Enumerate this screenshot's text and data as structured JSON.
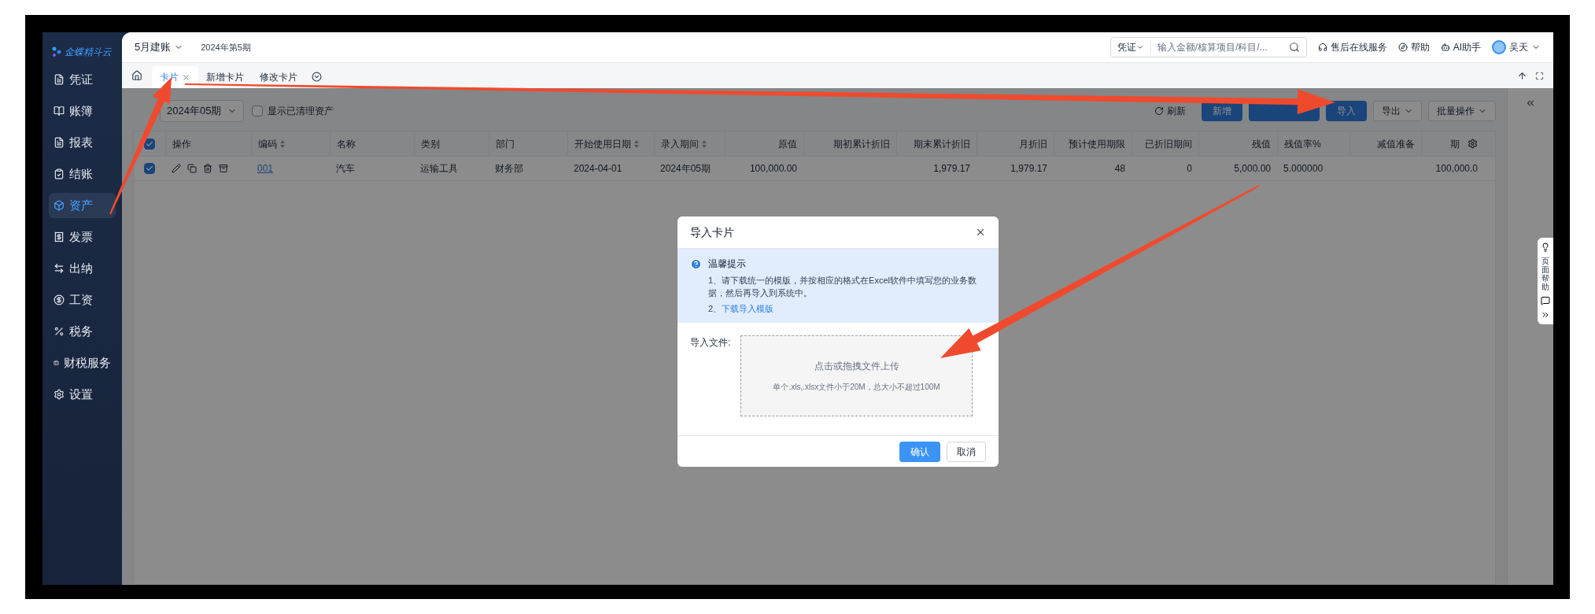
{
  "logo": "金蝶精斗云",
  "sidebar": {
    "items": [
      {
        "label": "凭证",
        "selected": false
      },
      {
        "label": "账簿",
        "selected": false
      },
      {
        "label": "报表",
        "selected": false
      },
      {
        "label": "结账",
        "selected": false
      },
      {
        "label": "资产",
        "selected": true
      },
      {
        "label": "发票",
        "selected": false
      },
      {
        "label": "出纳",
        "selected": false
      },
      {
        "label": "工资",
        "selected": false
      },
      {
        "label": "税务",
        "selected": false
      },
      {
        "label": "财税服务",
        "selected": false
      },
      {
        "label": "设置",
        "selected": false
      }
    ]
  },
  "header": {
    "account": "5月建账",
    "period": "2024年第5期",
    "search_type": "凭证",
    "search_placeholder": "输入金额/核算项目/科目/...",
    "links": [
      "售后在线服务",
      "帮助",
      "AI助手"
    ],
    "user": "吴天"
  },
  "tabs": [
    {
      "label": "卡片",
      "selected": true,
      "closable": true
    },
    {
      "label": "新增卡片",
      "selected": false,
      "closable": false
    },
    {
      "label": "修改卡片",
      "selected": false,
      "closable": false
    }
  ],
  "toolbar": {
    "period": "2024年05期",
    "show_cleared": {
      "label": "显示已清理资产",
      "checked": false
    },
    "refresh": "刷新",
    "buttons": [
      {
        "label": "新增",
        "kind": "primary"
      },
      {
        "kind": "primary"
      },
      {
        "label": "导入",
        "kind": "primary"
      },
      {
        "label": "导出",
        "kind": "menu"
      },
      {
        "label": "批量操作",
        "kind": "menu"
      }
    ]
  },
  "table": {
    "header_checked": true,
    "columns": [
      {
        "label": "操作",
        "kind": "actions",
        "sortable": false
      },
      {
        "label": "编码",
        "kind": "link",
        "sortable": true
      },
      {
        "label": "名称",
        "kind": "text",
        "sortable": false
      },
      {
        "label": "类别",
        "kind": "text",
        "sortable": false
      },
      {
        "label": "部门",
        "kind": "text",
        "sortable": false
      },
      {
        "label": "开始使用日期",
        "kind": "text",
        "sortable": true
      },
      {
        "label": "录入期间",
        "kind": "text",
        "sortable": true
      },
      {
        "label": "原值",
        "kind": "number",
        "sortable": false
      },
      {
        "label": "期初累计折旧",
        "kind": "number",
        "sortable": false
      },
      {
        "label": "期末累计折旧",
        "kind": "number",
        "sortable": false
      },
      {
        "label": "月折旧",
        "kind": "number",
        "sortable": false
      },
      {
        "label": "预计使用期限",
        "kind": "number",
        "sortable": false
      },
      {
        "label": "已折旧期间",
        "kind": "number",
        "sortable": false
      },
      {
        "label": "残值",
        "kind": "number",
        "sortable": false
      },
      {
        "label": "残值率%",
        "kind": "text",
        "sortable": false
      },
      {
        "label": "减值准备",
        "kind": "number",
        "sortable": false
      },
      {
        "label": "期",
        "kind": "number",
        "sortable": false
      }
    ],
    "rows": [
      {
        "checked": true,
        "cells": [
          "",
          "001",
          "汽车",
          "运输工具",
          "财务部",
          "2024-04-01",
          "2024年05期",
          "100,000.00",
          "",
          "1,979.17",
          "1,979.17",
          "48",
          "0",
          "5,000.00",
          "5.000000",
          "",
          "100,000.0"
        ]
      }
    ]
  },
  "help_widget": "页面帮助",
  "dialog": {
    "title": "导入卡片",
    "tip_title": "温馨提示",
    "tip_line": "1、请下载统一的模版，并按相应的格式在Excel软件中填写您的业务数据，然后再导入到系统中。",
    "tip_prefix": "2、",
    "tip_link": "下载导入模版",
    "field_label": "导入文件:",
    "upload_title": "点击或拖拽文件上传",
    "upload_hint": "单个.xls,.xlsx文件小于20M，总大小不超过100M",
    "confirm": "确认",
    "cancel": "取消"
  }
}
